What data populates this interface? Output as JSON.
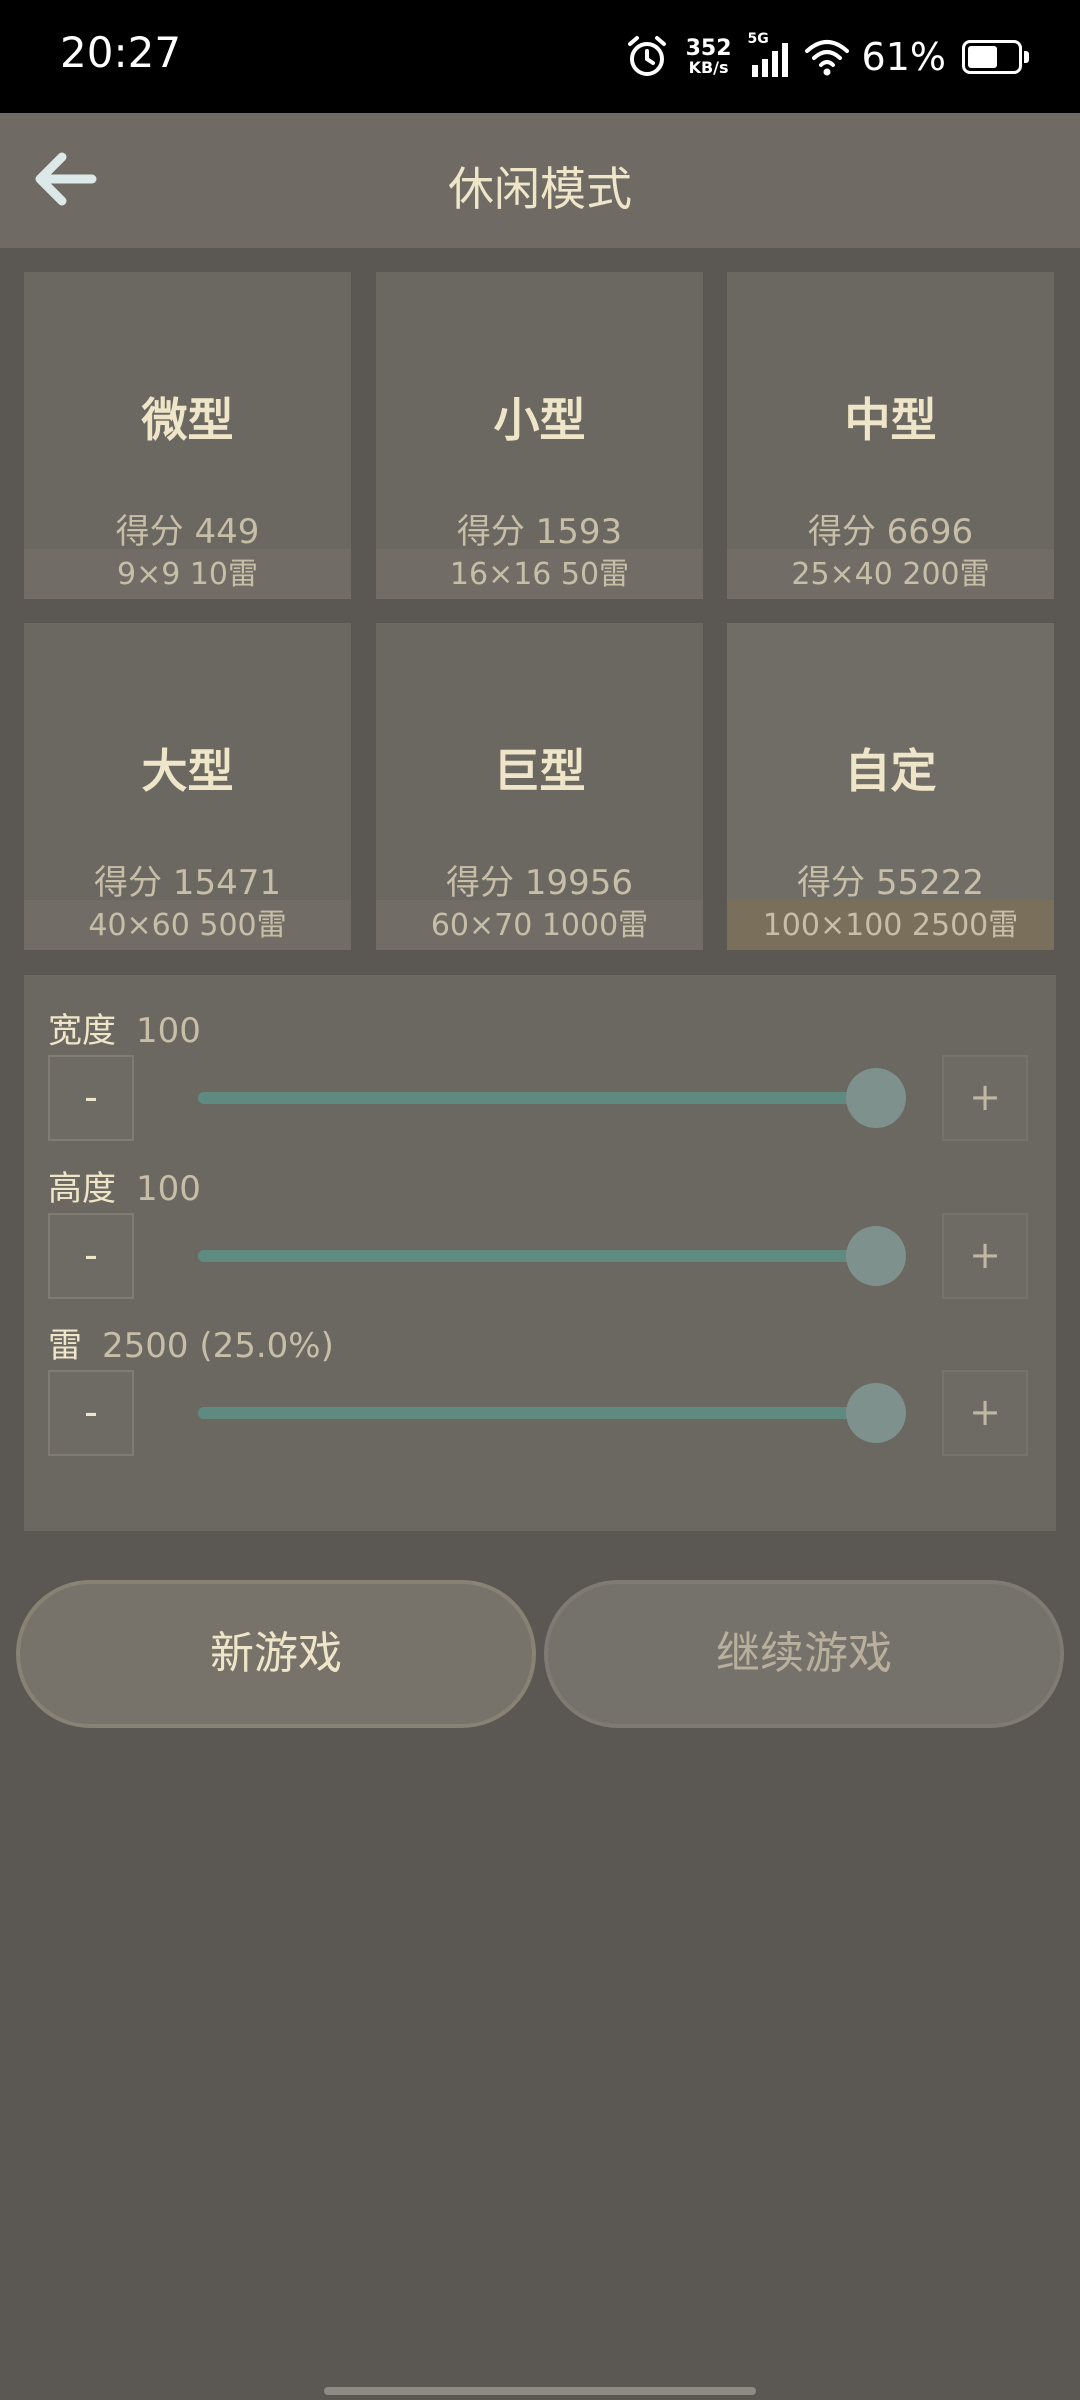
{
  "status_bar": {
    "time": "20:27",
    "net_speed_value": "352",
    "net_speed_unit": "KB/s",
    "network_type": "5G",
    "battery_percent": "61%",
    "battery_level": 0.61
  },
  "header": {
    "title": "休闲模式",
    "back_icon": "arrow-left-icon"
  },
  "modes": [
    {
      "name": "微型",
      "score": "得分 449",
      "spec": "9×9  10雷"
    },
    {
      "name": "小型",
      "score": "得分 1593",
      "spec": "16×16  50雷"
    },
    {
      "name": "中型",
      "score": "得分 6696",
      "spec": "25×40  200雷"
    },
    {
      "name": "大型",
      "score": "得分 15471",
      "spec": "40×60  500雷"
    },
    {
      "name": "巨型",
      "score": "得分 19956",
      "spec": "60×70  1000雷"
    },
    {
      "name": "自定",
      "score": "得分 55222",
      "spec": "100×100  2500雷",
      "selected": true
    }
  ],
  "settings": {
    "width": {
      "label": "宽度",
      "value": "100",
      "level": 1.0,
      "minus": "-",
      "plus": "+"
    },
    "height": {
      "label": "高度",
      "value": "100",
      "level": 1.0,
      "minus": "-",
      "plus": "+"
    },
    "mines": {
      "label": "雷",
      "value": "2500 (25.0%)",
      "level": 1.0,
      "minus": "-",
      "plus": "+"
    }
  },
  "actions": {
    "new_game": "新游戏",
    "continue_game": "继续游戏"
  },
  "colors": {
    "background": "#5b5752",
    "panel": "#6b6761",
    "text_primary": "#efe5c8",
    "text_secondary": "#c7bea8",
    "slider_fill": "#5f8a7f",
    "selected_accent": "#7a6f5b"
  }
}
